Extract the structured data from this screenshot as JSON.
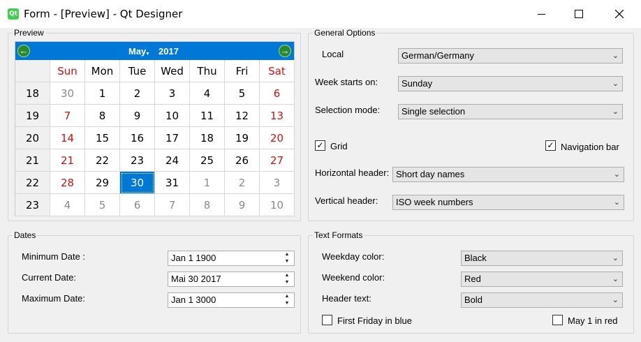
{
  "window": {
    "title": "Form - [Preview] - Qt Designer",
    "icon_text": "Qt"
  },
  "preview": {
    "title": "Preview",
    "calendar": {
      "month": "May",
      "year": "2017",
      "prev_icon": "green-left-arrow",
      "next_icon": "green-right-arrow",
      "day_headers": [
        "Sun",
        "Mon",
        "Tue",
        "Wed",
        "Thu",
        "Fri",
        "Sat"
      ],
      "weeks": [
        {
          "week": "18",
          "days": [
            "30",
            "1",
            "2",
            "3",
            "4",
            "5",
            "6"
          ]
        },
        {
          "week": "19",
          "days": [
            "7",
            "8",
            "9",
            "10",
            "11",
            "12",
            "13"
          ]
        },
        {
          "week": "20",
          "days": [
            "14",
            "15",
            "16",
            "17",
            "18",
            "19",
            "20"
          ]
        },
        {
          "week": "21",
          "days": [
            "21",
            "22",
            "23",
            "24",
            "25",
            "26",
            "27"
          ]
        },
        {
          "week": "22",
          "days": [
            "28",
            "29",
            "30",
            "31",
            "1",
            "2",
            "3"
          ]
        },
        {
          "week": "23",
          "days": [
            "4",
            "5",
            "6",
            "7",
            "8",
            "9",
            "10"
          ]
        }
      ],
      "selected_day": "30",
      "weekend_color": "#d01010",
      "selection_color": "#0078d7"
    }
  },
  "general": {
    "title": "General Options",
    "local_label": "Local",
    "local_value": "German/Germany",
    "week_start_label": "Week starts on:",
    "week_start_value": "Sunday",
    "selection_mode_label": "Selection mode:",
    "selection_mode_value": "Single selection",
    "grid_label": "Grid",
    "grid_checked": true,
    "navbar_label": "Navigation bar",
    "navbar_checked": true,
    "hheader_label": "Horizontal header:",
    "hheader_value": "Short day names",
    "vheader_label": "Vertical header:",
    "vheader_value": "ISO week numbers"
  },
  "dates": {
    "title": "Dates",
    "min_label": "Minimum Date :",
    "min_value": "Jan 1 1900",
    "cur_label": "Current Date:",
    "cur_value": "Mai 30 2017",
    "max_label": "Maximum Date:",
    "max_value": "Jan 1 3000"
  },
  "text_formats": {
    "title": "Text Formats",
    "weekday_label": "Weekday color:",
    "weekday_value": "Black",
    "weekend_label": "Weekend color:",
    "weekend_value": "Red",
    "header_label": "Header text:",
    "header_value": "Bold",
    "first_friday_label": "First Friday in blue",
    "first_friday_checked": false,
    "may1_label": "May 1 in red",
    "may1_checked": false
  }
}
